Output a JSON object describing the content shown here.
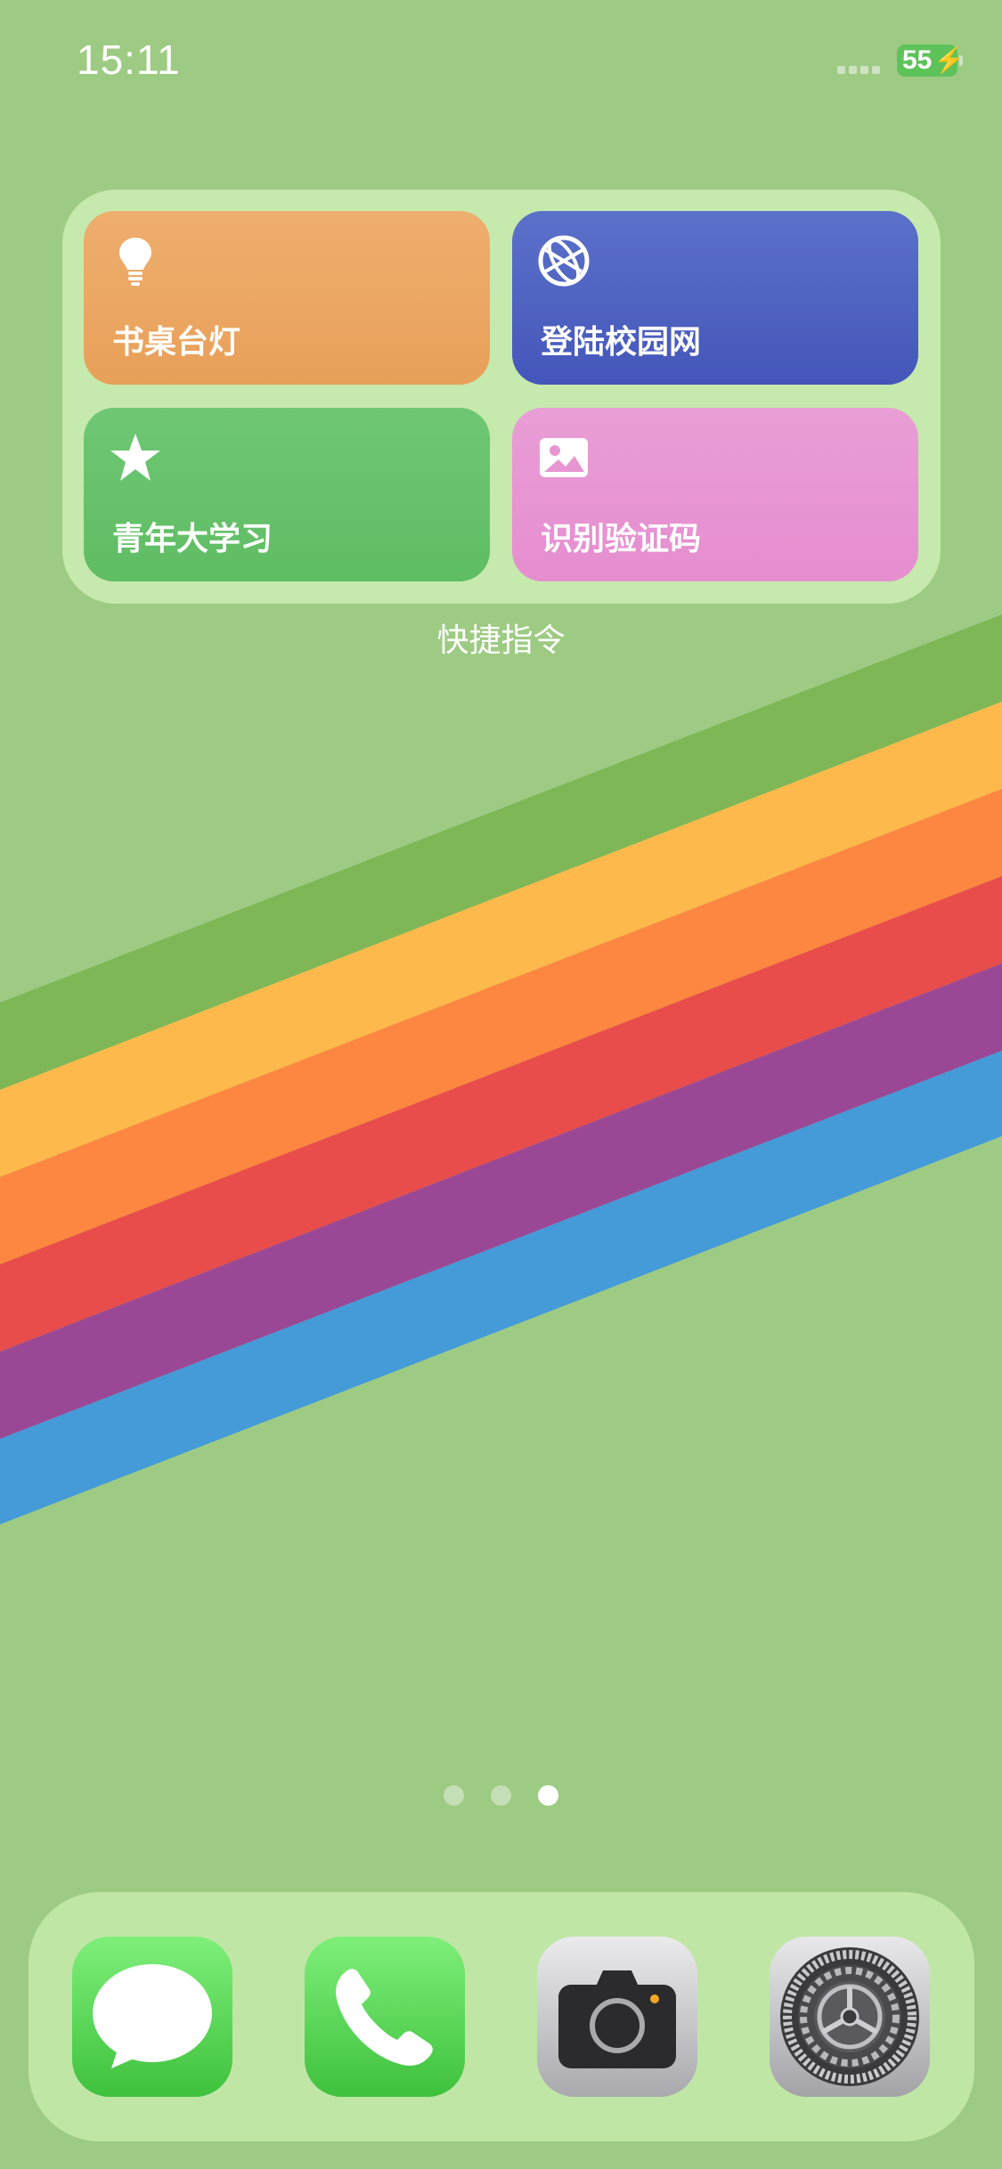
{
  "status_bar": {
    "time": "15:11",
    "battery_level": "55",
    "charging": true
  },
  "widget": {
    "title": "快捷指令",
    "tiles": [
      {
        "label": "书桌台灯",
        "icon": "lightbulb-icon",
        "color": "#eba764"
      },
      {
        "label": "登陆校园网",
        "icon": "globe-icon",
        "color": "#4d63c1"
      },
      {
        "label": "青年大学习",
        "icon": "star-icon",
        "color": "#66c26b"
      },
      {
        "label": "识别验证码",
        "icon": "photo-icon",
        "color": "#e796d2"
      }
    ]
  },
  "page_indicator": {
    "count": 3,
    "active_index": 2
  },
  "dock": {
    "apps": [
      {
        "name": "messages",
        "icon": "messages-icon"
      },
      {
        "name": "phone",
        "icon": "phone-icon"
      },
      {
        "name": "camera",
        "icon": "camera-icon"
      },
      {
        "name": "settings",
        "icon": "gear-icon"
      }
    ]
  },
  "colors": {
    "wallpaper_green": "#9ecb83",
    "stripe_green": "#7fb757",
    "stripe_yellow": "#fdb94c",
    "stripe_orange": "#fd8640",
    "stripe_red": "#e84d4b",
    "stripe_purple": "#9a4896",
    "stripe_blue": "#449bd8"
  }
}
